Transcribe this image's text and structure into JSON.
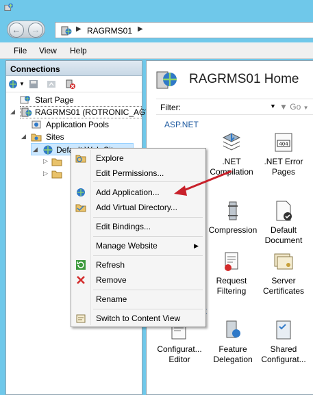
{
  "window": {
    "app_icon": "iis-manager-icon"
  },
  "address_bar": {
    "crumb": "RAGRMS01"
  },
  "menu": {
    "file": "File",
    "view": "View",
    "help": "Help"
  },
  "connections": {
    "title": "Connections",
    "tree": {
      "start_page": "Start Page",
      "server": "RAGRMS01 (ROTRONIC_AG\\j",
      "app_pools": "Application Pools",
      "sites": "Sites",
      "default_site": "Default Web Site"
    }
  },
  "home": {
    "title": "RAGRMS01 Home",
    "filter_label": "Filter:",
    "go_label": "Go",
    "aspnet_section": "ASP.NET",
    "partial_section": "nt",
    "features": {
      "net_compilation": ".NET Compilation",
      "net_error_pages": ".NET Error Pages",
      "compression": "Compression",
      "default_document": "Default Document",
      "request_filtering": "Request Filtering",
      "server_certificates": "Server Certificates",
      "config_editor": "Configurat... Editor",
      "feature_delegation": "Feature Delegation",
      "shared_config": "Shared Configurat..."
    }
  },
  "context_menu": {
    "explore": "Explore",
    "edit_permissions": "Edit Permissions...",
    "add_application": "Add Application...",
    "add_virtual_directory": "Add Virtual Directory...",
    "edit_bindings": "Edit Bindings...",
    "manage_website": "Manage Website",
    "refresh": "Refresh",
    "remove": "Remove",
    "rename": "Rename",
    "switch_to_content_view": "Switch to Content View"
  },
  "colors": {
    "accent_arrow": "#c8202a",
    "window_chrome": "#6fc8ea"
  }
}
